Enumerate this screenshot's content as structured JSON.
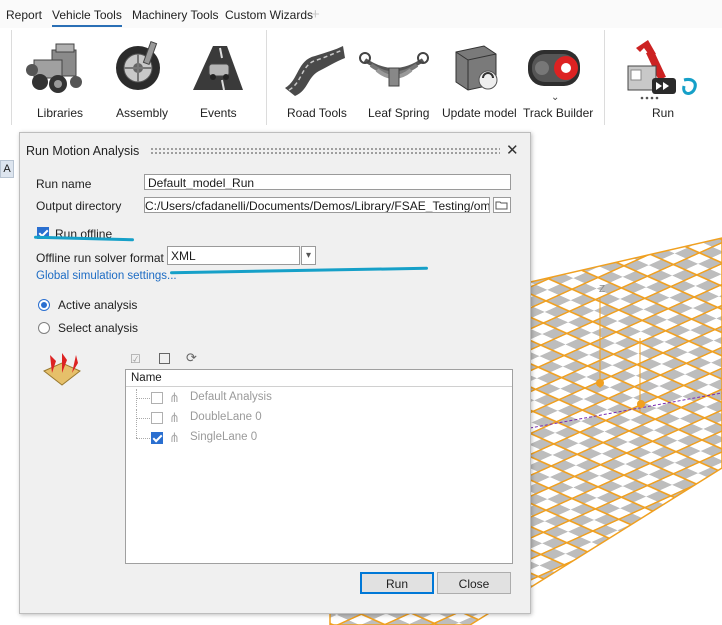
{
  "menu_tabs": [
    {
      "label": "Report"
    },
    {
      "label": "Vehicle Tools"
    },
    {
      "label": "Machinery Tools"
    },
    {
      "label": "Custom Wizards"
    }
  ],
  "ribbon": {
    "tools": [
      {
        "label": "Libraries",
        "icon": "libraries-icon"
      },
      {
        "label": "Assembly",
        "icon": "assembly-icon"
      },
      {
        "label": "Events",
        "icon": "events-icon"
      },
      {
        "label": "Road Tools",
        "icon": "road-tools-icon"
      },
      {
        "label": "Leaf Spring",
        "icon": "leaf-spring-icon"
      },
      {
        "label": "Update model",
        "icon": "update-model-icon"
      },
      {
        "label": "Track Builder",
        "icon": "track-builder-icon"
      },
      {
        "label": "Run",
        "icon": "run-icon"
      }
    ]
  },
  "side_tab": {
    "label": "A"
  },
  "viewport": {
    "axis_label": "Z",
    "grid_color": "#f0a020"
  },
  "dialog": {
    "title": "Run Motion Analysis",
    "close_glyph": "✕",
    "run_name_label": "Run name",
    "run_name_value": "Default_model_Run",
    "output_dir_label": "Output directory",
    "output_dir_value": "C:/Users/cfadanelli/Documents/Demos/Library/FSAE_Testing/omit/res",
    "run_offline_label": "Run offline",
    "run_offline_checked": true,
    "solver_format_label": "Offline run solver format",
    "solver_format_value": "XML",
    "global_settings_link": "Global simulation settings...",
    "active_analysis_label": "Active analysis",
    "select_analysis_label": "Select analysis",
    "tree_header": "Name",
    "tree_items": [
      {
        "label": "Default Analysis",
        "checked": false
      },
      {
        "label": "DoubleLane 0",
        "checked": false
      },
      {
        "label": "SingleLane 0",
        "checked": true
      }
    ],
    "run_button": "Run",
    "close_button": "Close"
  },
  "colors": {
    "accent": "#2a6fd0",
    "link": "#1d6cc4",
    "annotation_pen": "#16a0c8",
    "mesh": "#f0a020"
  }
}
